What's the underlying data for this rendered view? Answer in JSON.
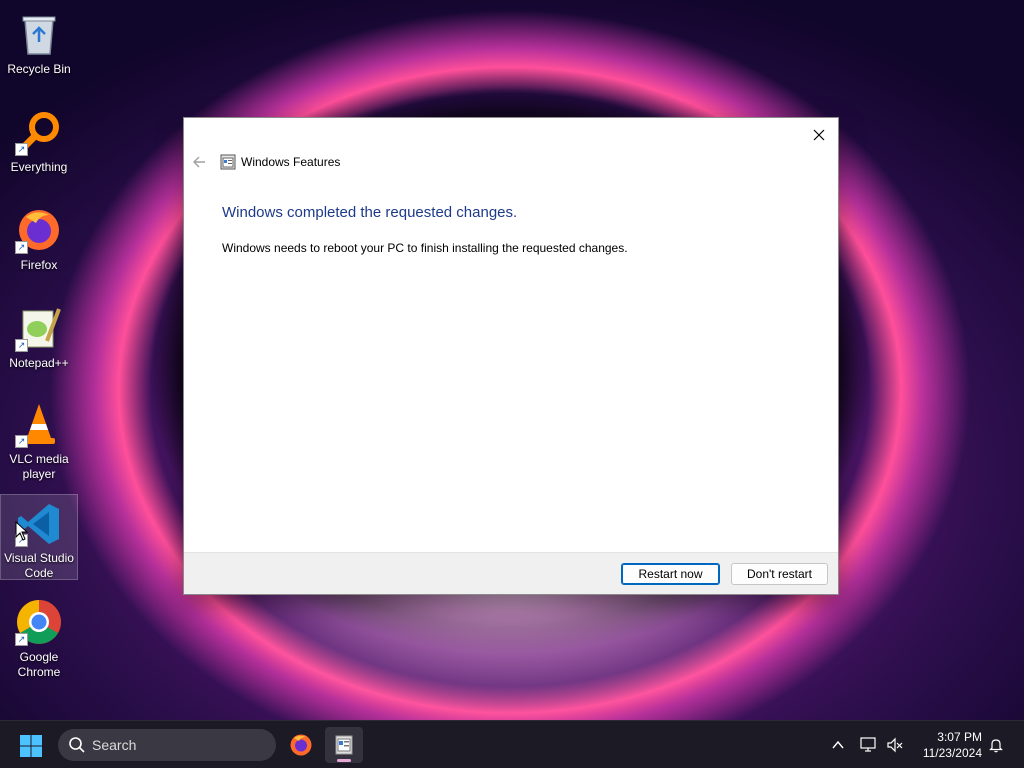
{
  "desktop": {
    "icons": [
      {
        "label": "Recycle Bin",
        "icon": "recycle-bin-icon"
      },
      {
        "label": "Everything",
        "icon": "everything-search-icon"
      },
      {
        "label": "Firefox",
        "icon": "firefox-icon"
      },
      {
        "label": "Notepad++",
        "icon": "notepad-plus-plus-icon"
      },
      {
        "label": "VLC media player",
        "icon": "vlc-icon"
      },
      {
        "label": "Visual Studio Code",
        "icon": "vscode-icon"
      },
      {
        "label": "Google Chrome",
        "icon": "chrome-icon"
      }
    ]
  },
  "dialog": {
    "title": "Windows Features",
    "heading": "Windows completed the requested changes.",
    "message": "Windows needs to reboot your PC to finish installing the requested changes.",
    "restart_label": "Restart now",
    "dont_restart_label": "Don't restart"
  },
  "taskbar": {
    "search_placeholder": "Search",
    "time": "3:07 PM",
    "date": "11/23/2024"
  },
  "colors": {
    "heading": "#1e3a8a",
    "primary_border": "#0067c0",
    "taskbar": "#1c1a24"
  }
}
